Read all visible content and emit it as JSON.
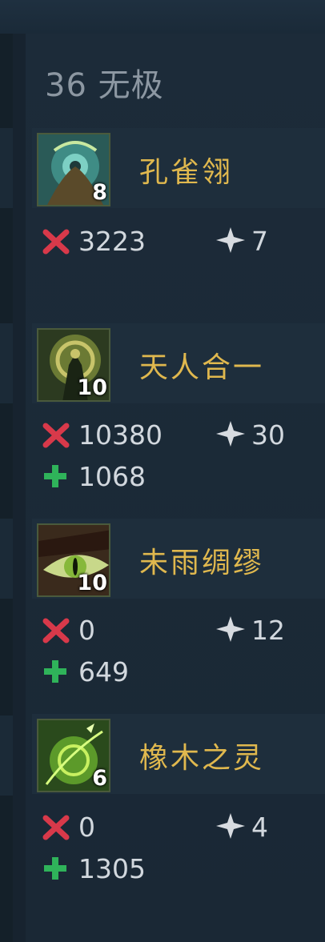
{
  "header": {
    "title": "36 无极"
  },
  "items": [
    {
      "name": "孔雀翎",
      "level": "8",
      "damage": "3223",
      "kills": "7",
      "heal": "",
      "icon": "peacock-feather-icon"
    },
    {
      "name": "天人合一",
      "level": "10",
      "damage": "10380",
      "kills": "30",
      "heal": "1068",
      "icon": "unity-armor-icon"
    },
    {
      "name": "未雨绸缪",
      "level": "10",
      "damage": "0",
      "kills": "12",
      "heal": "649",
      "icon": "eye-icon"
    },
    {
      "name": "橡木之灵",
      "level": "6",
      "damage": "0",
      "kills": "4",
      "heal": "1305",
      "icon": "oak-spirit-icon"
    }
  ],
  "colors": {
    "damage": "#d8394a",
    "heal": "#2fb35a",
    "kill": "#d7dbe0",
    "name": "#e0b84e"
  }
}
